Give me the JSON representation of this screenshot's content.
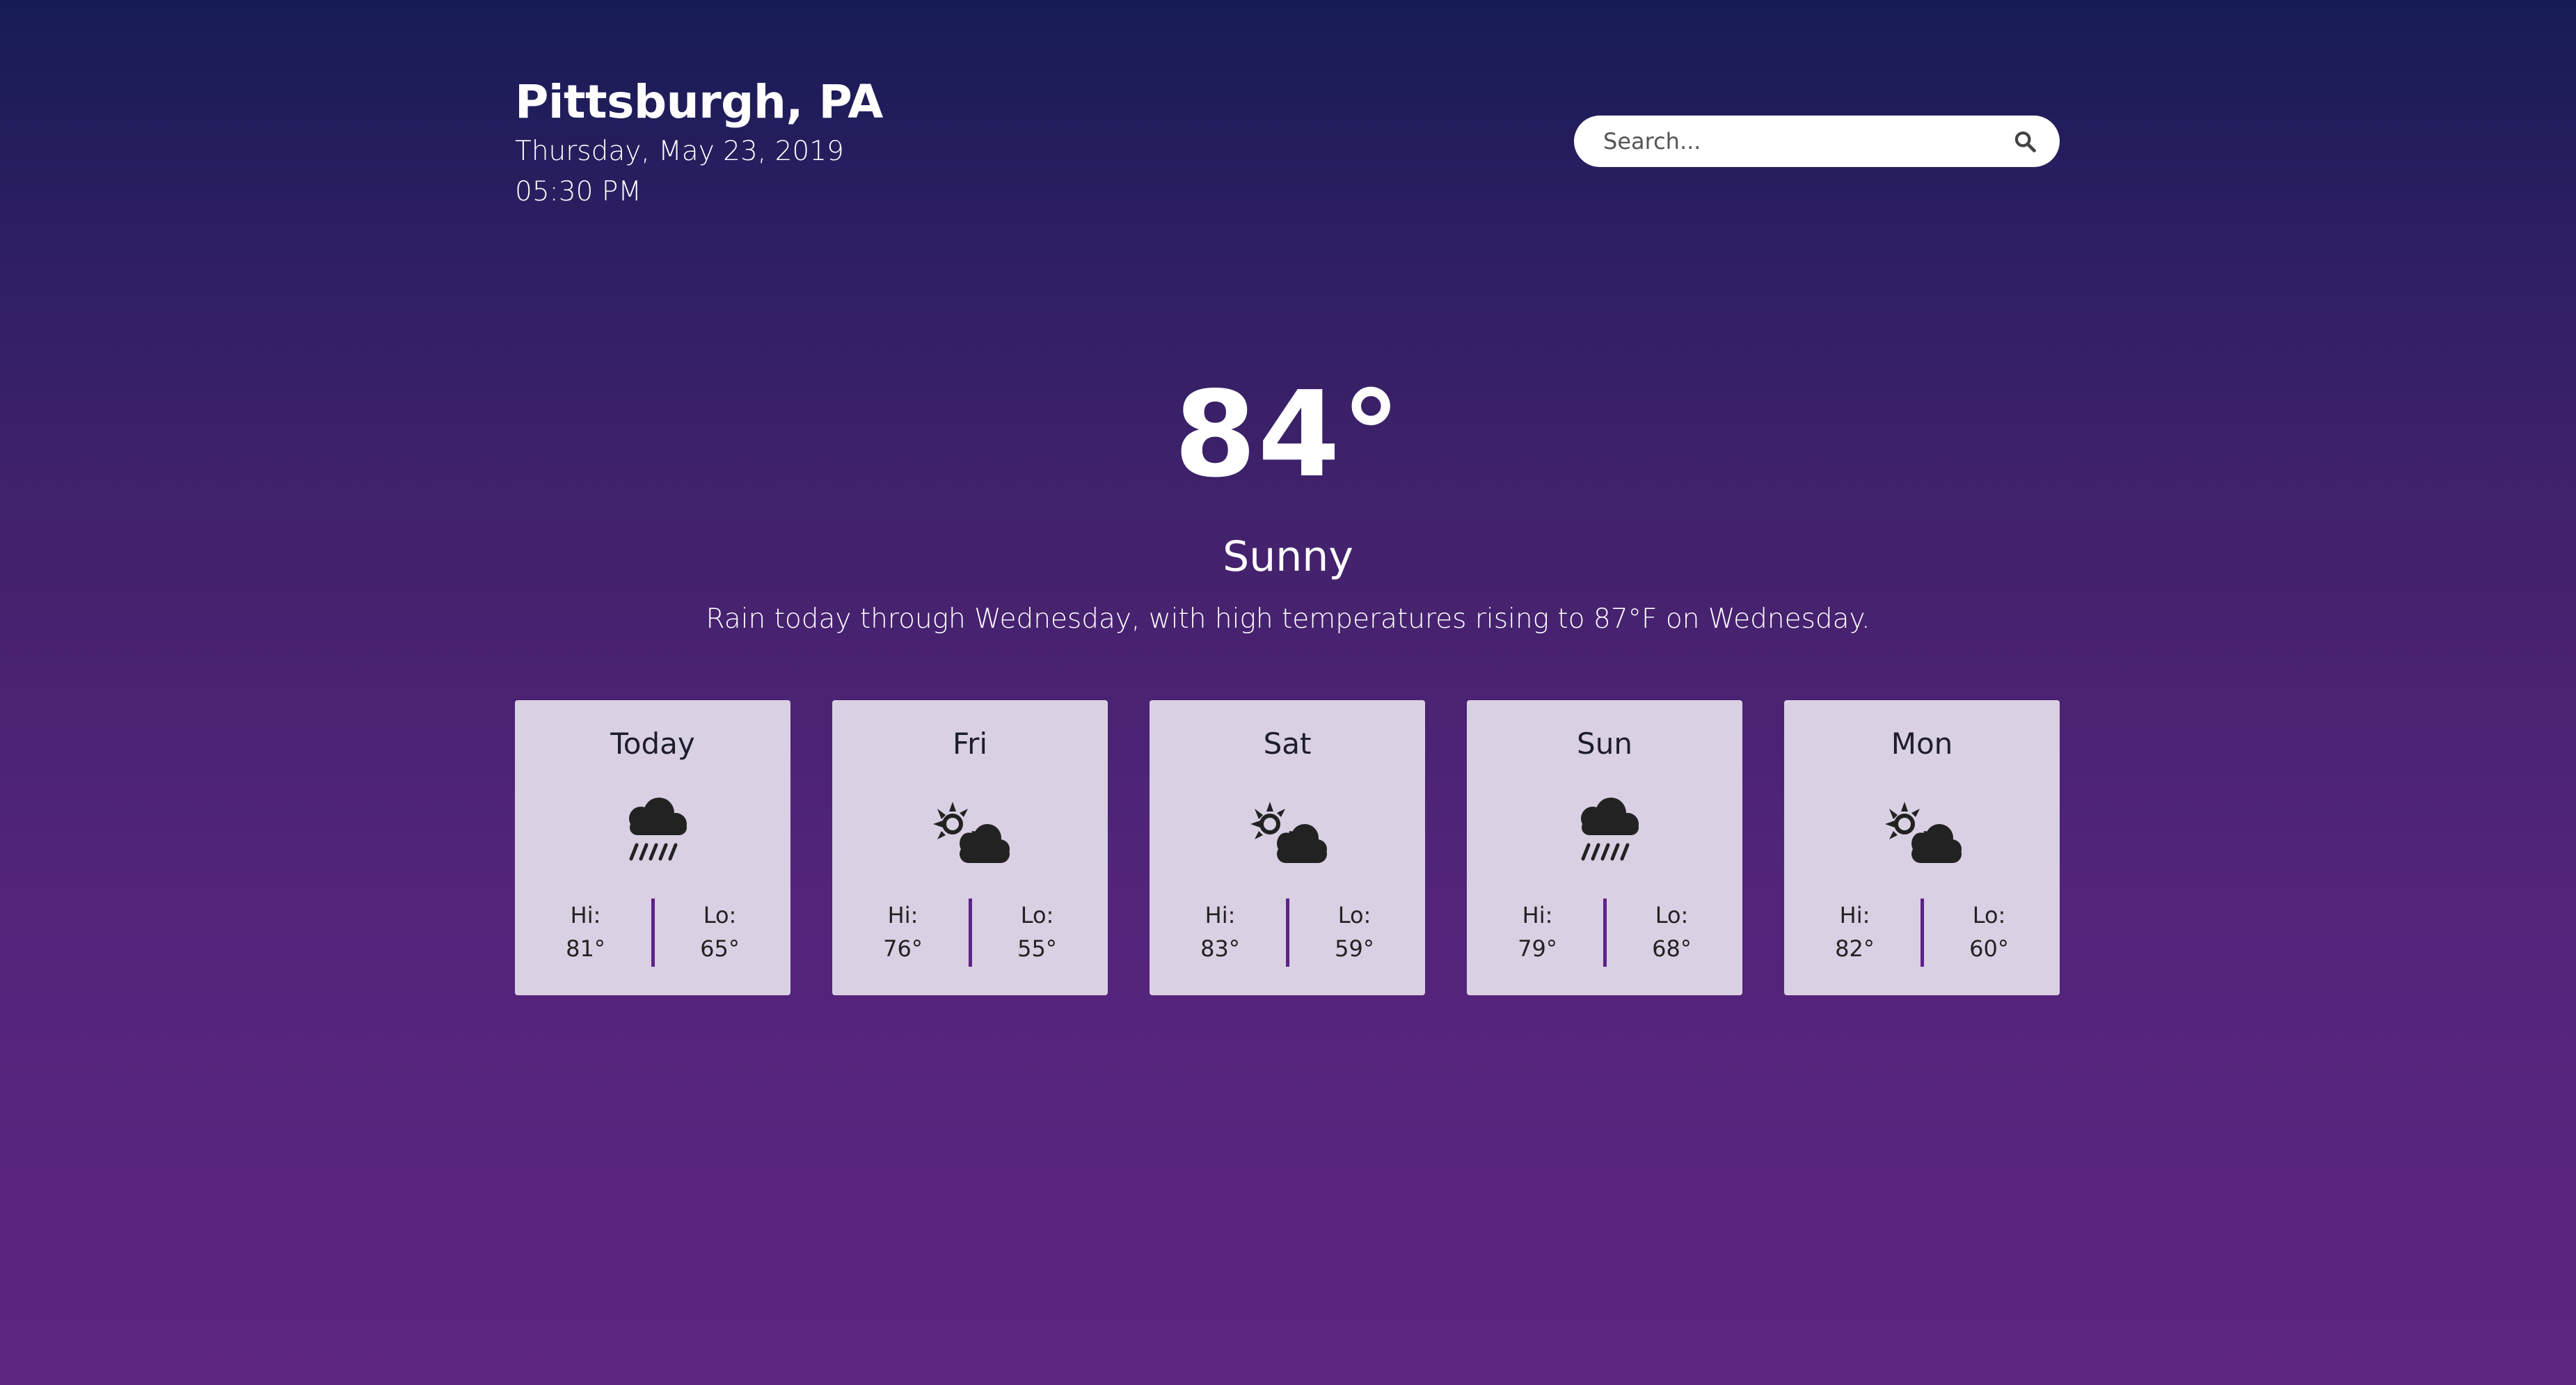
{
  "location": {
    "city": "Pittsburgh, PA",
    "date": "Thursday, May 23, 2019",
    "time": "05:30 PM"
  },
  "search": {
    "placeholder": "Search...",
    "icon": "search-icon"
  },
  "current": {
    "temperature": "84°",
    "condition": "Sunny",
    "summary": "Rain today through Wednesday, with high temperatures rising to 87°F on Wednesday."
  },
  "forecast": [
    {
      "day": "Today",
      "icon": "rain-icon",
      "hi_label": "Hi:",
      "hi": "81°",
      "lo_label": "Lo:",
      "lo": "65°"
    },
    {
      "day": "Fri",
      "icon": "partly-cloudy-icon",
      "hi_label": "Hi:",
      "hi": "76°",
      "lo_label": "Lo:",
      "lo": "55°"
    },
    {
      "day": "Sat",
      "icon": "partly-cloudy-icon",
      "hi_label": "Hi:",
      "hi": "83°",
      "lo_label": "Lo:",
      "lo": "59°"
    },
    {
      "day": "Sun",
      "icon": "rain-icon",
      "hi_label": "Hi:",
      "hi": "79°",
      "lo_label": "Lo:",
      "lo": "68°"
    },
    {
      "day": "Mon",
      "icon": "partly-cloudy-icon",
      "hi_label": "Hi:",
      "hi": "82°",
      "lo_label": "Lo:",
      "lo": "60°"
    }
  ],
  "colors": {
    "background_top": "#161b55",
    "background_bottom": "#5e2681",
    "card_background": "#dad0e3",
    "divider": "#5d2389"
  }
}
